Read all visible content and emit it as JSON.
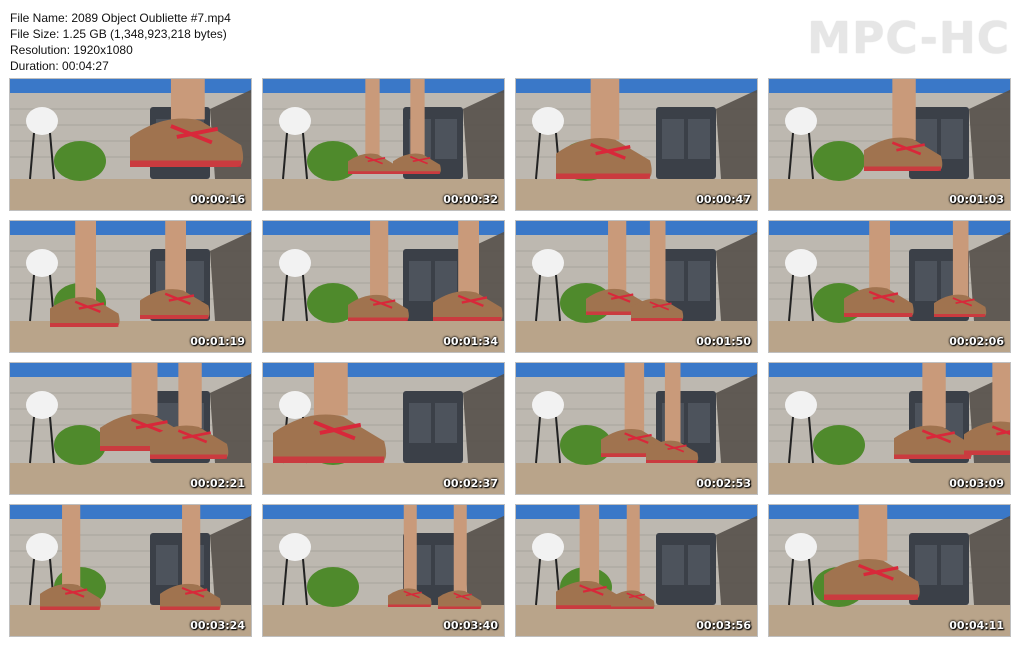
{
  "info": {
    "file_name": "File Name: 2089 Object Oubliette #7.mp4",
    "file_size": "File Size: 1.25 GB (1,348,923,218 bytes)",
    "resolution": "Resolution: 1920x1080",
    "duration": "Duration: 00:04:27"
  },
  "logo": "MPC-HC",
  "thumbnails": [
    "00:00:16",
    "00:00:32",
    "00:00:47",
    "00:01:03",
    "00:01:19",
    "00:01:34",
    "00:01:50",
    "00:02:06",
    "00:02:21",
    "00:02:37",
    "00:02:53",
    "00:03:09",
    "00:03:24",
    "00:03:40",
    "00:03:56",
    "00:04:11"
  ],
  "colors": {
    "sky": "#3a78c8",
    "wall": "#bdb8b0",
    "ground": "#b9a48a",
    "grill": "#3b4048",
    "plant": "#4f8a2c",
    "boot": "#a0734f",
    "laces": "#d8283a",
    "skin": "#c99a7a",
    "pot": "#f2f2f2"
  }
}
